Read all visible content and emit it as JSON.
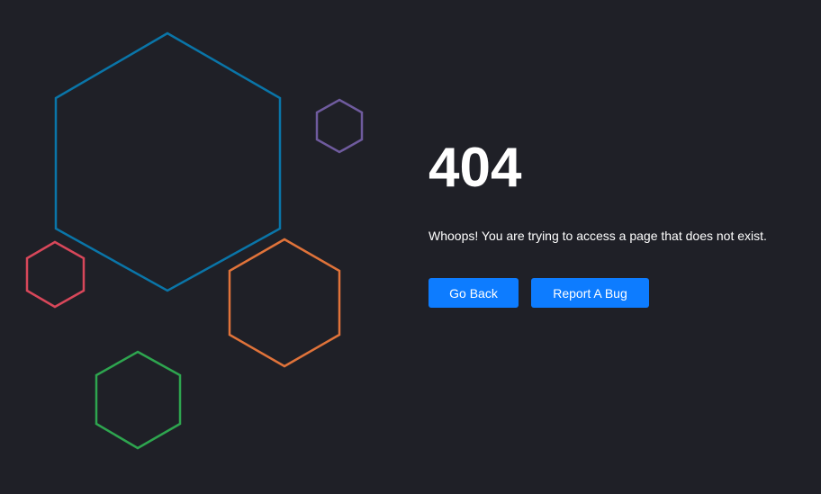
{
  "error": {
    "code": "404",
    "message": "Whoops! You are trying to access a page that does not exist."
  },
  "actions": {
    "back_label": "Go Back",
    "bug_label": "Report A Bug"
  },
  "colors": {
    "background": "#1f2027",
    "button": "#0d7cff",
    "hex_blue": "#0a75a8",
    "hex_purple": "#6f5b9e",
    "hex_red": "#d8475a",
    "hex_orange": "#e0733a",
    "hex_green": "#2ea54f"
  }
}
